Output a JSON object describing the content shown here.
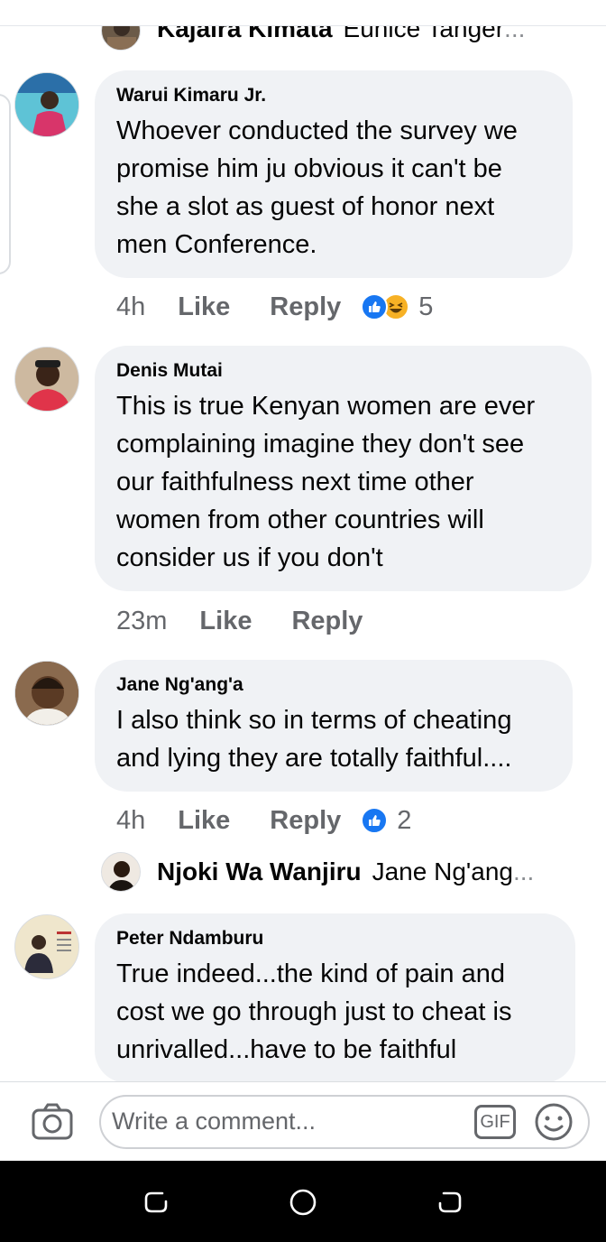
{
  "top_reply": {
    "author": "Kajaira Kimata",
    "text": "Eunice Tanger",
    "ellipsis": "..."
  },
  "comments": [
    {
      "author": "Warui Kimaru Jr.",
      "lines": [
        "Whoever conducted the survey we",
        "promise him ju obvious it can't be",
        "she a slot as guest of honor next",
        "men Conference."
      ],
      "time": "4h",
      "like_label": "Like",
      "reply_label": "Reply",
      "reactions": [
        "like",
        "haha"
      ],
      "reaction_count": "5"
    },
    {
      "author": "Denis Mutai",
      "lines": [
        "This is true Kenyan women are ever",
        "complaining imagine  they don't see",
        "our faithfulness next time other",
        "women from other countries will",
        "consider us if you don't"
      ],
      "time": "23m",
      "like_label": "Like",
      "reply_label": "Reply"
    },
    {
      "author": "Jane Ng'ang'a",
      "lines": [
        "I also think so in terms of cheating",
        "and lying they are totally faithful...."
      ],
      "time": "4h",
      "like_label": "Like",
      "reply_label": "Reply",
      "reactions": [
        "like"
      ],
      "reaction_count": "2"
    },
    {
      "author": "Peter Ndamburu",
      "lines": [
        "True indeed...the kind of pain and",
        "cost we go through just to cheat is",
        "unrivalled...have to be faithful"
      ]
    }
  ],
  "nested_reply": {
    "author": "Njoki Wa Wanjiru",
    "text": "Jane Ng'ang",
    "ellipsis": "..."
  },
  "composer": {
    "placeholder": "Write a comment...",
    "gif_label": "GIF"
  },
  "icons": [
    "camera-icon",
    "gif-icon",
    "emoji-icon",
    "recent-apps-icon",
    "home-icon",
    "back-icon"
  ],
  "colors": {
    "bubble": "#f0f2f5",
    "meta_text": "#65676b",
    "like_blue": "#1877f2",
    "haha_yellow": "#f7b125"
  }
}
